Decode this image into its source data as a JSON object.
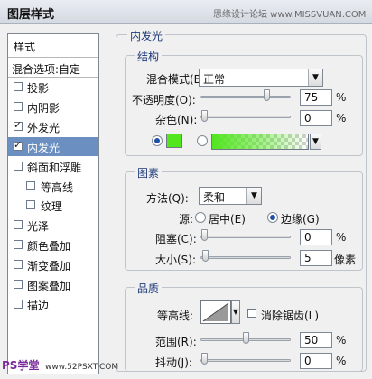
{
  "window": {
    "title": "图层样式",
    "watermark": "思缘设计论坛 www.MISSVUAN.COM"
  },
  "sidebar": {
    "header": "样式",
    "blend_options": "混合选项:自定",
    "items": [
      {
        "label": "投影",
        "checked": false,
        "indent": false,
        "selected": false
      },
      {
        "label": "内阴影",
        "checked": false,
        "indent": false,
        "selected": false
      },
      {
        "label": "外发光",
        "checked": true,
        "indent": false,
        "selected": false
      },
      {
        "label": "内发光",
        "checked": true,
        "indent": false,
        "selected": true
      },
      {
        "label": "斜面和浮雕",
        "checked": false,
        "indent": false,
        "selected": false
      },
      {
        "label": "等高线",
        "checked": false,
        "indent": true,
        "selected": false
      },
      {
        "label": "纹理",
        "checked": false,
        "indent": true,
        "selected": false
      },
      {
        "label": "光泽",
        "checked": false,
        "indent": false,
        "selected": false
      },
      {
        "label": "颜色叠加",
        "checked": false,
        "indent": false,
        "selected": false
      },
      {
        "label": "渐变叠加",
        "checked": false,
        "indent": false,
        "selected": false
      },
      {
        "label": "图案叠加",
        "checked": false,
        "indent": false,
        "selected": false
      },
      {
        "label": "描边",
        "checked": false,
        "indent": false,
        "selected": false
      }
    ]
  },
  "panel": {
    "title": "内发光",
    "structure": {
      "title": "结构",
      "blend_mode_label": "混合模式(B):",
      "blend_mode_value": "正常",
      "opacity_label": "不透明度(O):",
      "opacity_value": "75",
      "opacity_unit": "%",
      "opacity_fraction": 0.75,
      "noise_label": "杂色(N):",
      "noise_value": "0",
      "noise_unit": "%",
      "noise_fraction": 0,
      "glow_color": "#52e61f"
    },
    "elements": {
      "title": "图素",
      "technique_label": "方法(Q):",
      "technique_value": "柔和",
      "source_label": "源:",
      "source_center": "居中(E)",
      "source_edge": "边缘(G)",
      "choke_label": "阻塞(C):",
      "choke_value": "0",
      "choke_unit": "%",
      "choke_fraction": 0,
      "size_label": "大小(S):",
      "size_value": "5",
      "size_unit": "像素"
    },
    "quality": {
      "title": "品质",
      "contour_label": "等高线:",
      "antialias_label": "消除锯齿(L)",
      "range_label": "范围(R):",
      "range_value": "50",
      "range_unit": "%",
      "range_fraction": 0.5,
      "jitter_label": "抖动(J):",
      "jitter_value": "0",
      "jitter_unit": "%",
      "jitter_fraction": 0
    }
  },
  "footer": {
    "watermark_left": "PS学堂",
    "watermark_right": "www.52PSXT.COM"
  }
}
